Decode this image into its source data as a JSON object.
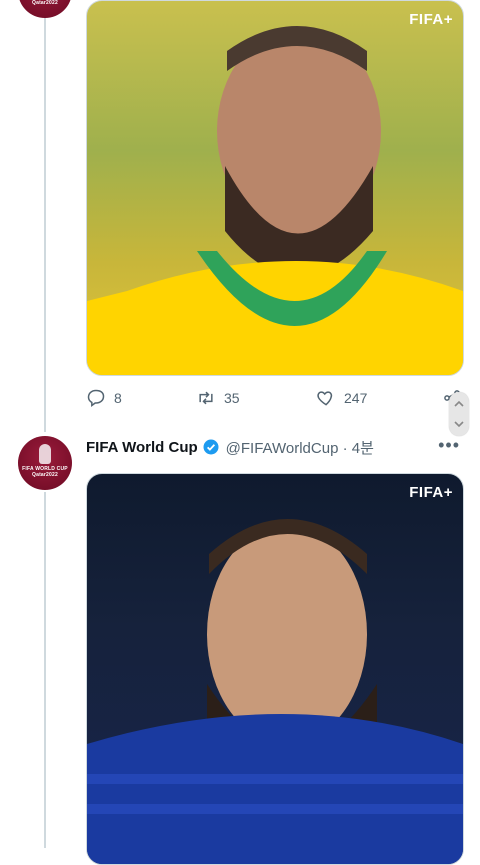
{
  "brand_label": "FIFA+",
  "tweet1": {
    "counts": {
      "replies": "8",
      "retweets": "35",
      "likes": "247"
    }
  },
  "tweet2": {
    "author_name": "FIFA World Cup",
    "handle_time": "@FIFAWorldCup · 4분",
    "avatar_caption": "FIFA WORLD CUP Qatar2022"
  },
  "colors": {
    "avatar_maroon": "#7a0f2a",
    "verified_blue": "#1d9bf0",
    "muted_text": "#536471",
    "thread_line": "#cfd9de"
  },
  "icons": [
    "reply-icon",
    "retweet-icon",
    "like-icon",
    "share-icon",
    "verified-icon",
    "more-icon"
  ]
}
